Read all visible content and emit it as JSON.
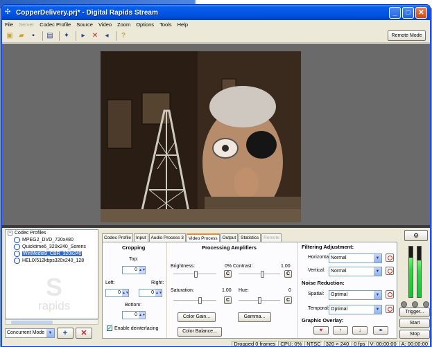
{
  "window": {
    "title": "CopperDelivery.prj* - Digital Rapids Stream"
  },
  "menu": [
    "File",
    "Server",
    "Codec Profile",
    "Source",
    "Video",
    "Zoom",
    "Options",
    "Tools",
    "Help"
  ],
  "menu_disabled": "Server",
  "toolbar": {
    "remote_mode": "Remote Mode"
  },
  "codec_profiles": {
    "header": "Codec Profiles",
    "items": [
      {
        "label": "MPEG2_DVD_720x480"
      },
      {
        "label": "Quicktime6_320x240_Sorens"
      },
      {
        "label": "WinMedia9_CBR_320x240"
      },
      {
        "label": "HELIX512kbps320x240_128"
      }
    ],
    "selected_index": 2,
    "logo_word": "rapids"
  },
  "mode": {
    "value": "Concurrent Mode",
    "add": "+",
    "remove": "✕"
  },
  "tabs": [
    {
      "label": "Codec Profile"
    },
    {
      "label": "Input"
    },
    {
      "label": "Audio Process 3"
    },
    {
      "label": "Video Process"
    },
    {
      "label": "Output"
    },
    {
      "label": "Statistics"
    },
    {
      "label": "Remote"
    }
  ],
  "cropping": {
    "title": "Cropping",
    "top_label": "Top:",
    "top_value": "0",
    "left_label": "Left:",
    "left_value": "0",
    "right_label": "Right:",
    "right_value": "0",
    "bottom_label": "Bottom:",
    "bottom_value": "0",
    "deinterlace_label": "Enable deinterlacing",
    "deinterlace_checked": true
  },
  "amps": {
    "title": "Processing Amplifiers",
    "brightness_label": "Brightness:",
    "brightness_value": "0%",
    "contrast_label": "Contrast:",
    "contrast_value": "1.00",
    "saturation_label": "Saturation:",
    "saturation_value": "1.00",
    "hue_label": "Hue:",
    "hue_value": "0",
    "reset": "C",
    "color_gain": "Color Gain...",
    "gamma": "Gamma...",
    "color_balance": "Color Balance..."
  },
  "filtering": {
    "title": "Filtering Adjustment:",
    "horizontal_label": "Horizontal:",
    "horizontal_value": "Normal",
    "vertical_label": "Vertical:",
    "vertical_value": "Normal"
  },
  "noise": {
    "title": "Noise Reduction:",
    "spatial_label": "Spatial:",
    "spatial_value": "Optimal",
    "temporal_label": "Temporal:",
    "temporal_value": "Optimal"
  },
  "overlay": {
    "title": "Graphic Overlay:"
  },
  "controls": {
    "trigger": "Trigger...",
    "start": "Start",
    "stop": "Stop"
  },
  "meters": {
    "left_level": 0.78,
    "right_level": 0.72
  },
  "status": {
    "dropped": "Dropped 0 frames",
    "cpu": "CPU: 0%",
    "standard": "NTSC",
    "resolution": "320 × 240",
    "fps": "0 fps",
    "video_tc": "V: 00:00:00",
    "audio_tc": "A: 00:00:00"
  },
  "colors": {
    "titlebar": "#0054e3",
    "panel": "#ece9d8",
    "selection": "#316ac5",
    "meter": "#38d24e"
  }
}
